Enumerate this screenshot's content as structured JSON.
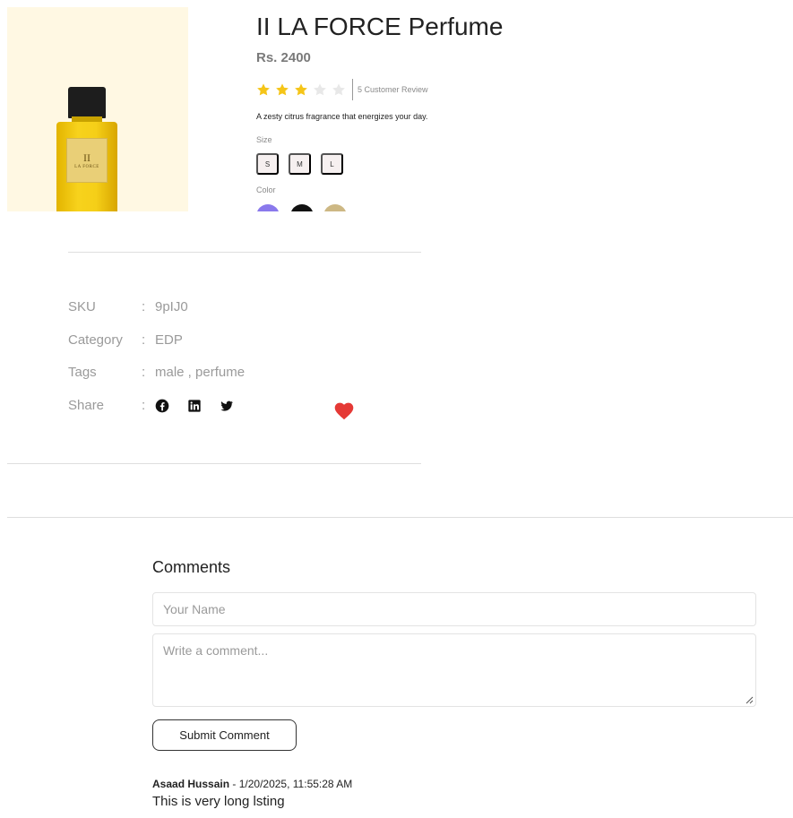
{
  "product": {
    "title": "II LA FORCE Perfume",
    "price": "Rs. 2400",
    "rating": 3,
    "rating_max": 5,
    "review_text": "5 Customer Review",
    "description": "A zesty citrus fragrance that energizes your day.",
    "size_label": "Size",
    "sizes": [
      "S",
      "M",
      "L"
    ],
    "color_label": "Color",
    "colors": [
      "#8a79ec",
      "#111111",
      "#cdb884"
    ],
    "image": {
      "label_big": "II",
      "label_small": "LA FORCE"
    }
  },
  "meta": {
    "sku_label": "SKU",
    "sku_value": "9pIJ0",
    "category_label": "Category",
    "category_value": "EDP",
    "tags_label": "Tags",
    "tags_value": "male , perfume",
    "share_label": "Share",
    "colon": ":",
    "share_icons": [
      "facebook-icon",
      "linkedin-icon",
      "twitter-icon"
    ]
  },
  "colors": {
    "star_filled": "#f5c518",
    "star_empty": "#e8e8e8",
    "heart": "#e53935"
  },
  "comments": {
    "title": "Comments",
    "name_placeholder": "Your Name",
    "comment_placeholder": "Write a comment...",
    "submit_label": "Submit Comment",
    "items": [
      {
        "author": "Asaad Hussain",
        "separator": " - ",
        "timestamp": "1/20/2025, 11:55:28 AM",
        "text": "This is very long lsting"
      }
    ]
  }
}
